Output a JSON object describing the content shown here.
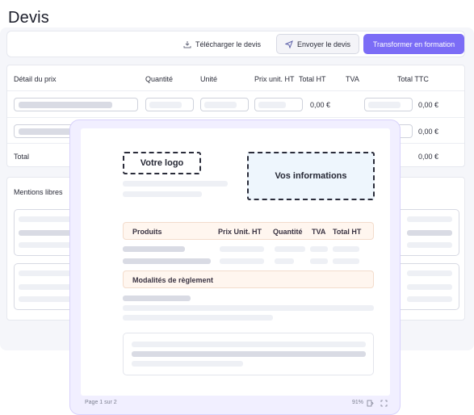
{
  "page": {
    "title": "Devis"
  },
  "toolbar": {
    "download_label": "Télécharger le devis",
    "send_label": "Envoyer le devis",
    "transform_label": "Transformer en formation"
  },
  "table": {
    "headers": [
      "Détail du prix",
      "Quantité",
      "Unité",
      "Prix unit. HT",
      "Total HT",
      "TVA",
      "Total TTC"
    ],
    "rows": [
      {
        "total_ht": "0,00 €",
        "total_ttc": "0,00 €"
      },
      {
        "total_ttc": "0,00 €"
      }
    ],
    "total_label": "Total",
    "total_value": "0,00 €"
  },
  "mentions": {
    "title": "Mentions libres"
  },
  "preview": {
    "logo_label": "Votre logo",
    "info_label": "Vos informations",
    "products_header": [
      "Produits",
      "Prix Unit. HT",
      "Quantité",
      "TVA",
      "Total HT"
    ],
    "payment_label": "Modalités de règlement",
    "page_indicator": "Page 1 sur 2",
    "zoom": "91%"
  },
  "colors": {
    "accent": "#7b6cf6",
    "preview_bg": "#f1efff",
    "info_box": "#eef6fd",
    "header_tint": "#fff6ef"
  }
}
